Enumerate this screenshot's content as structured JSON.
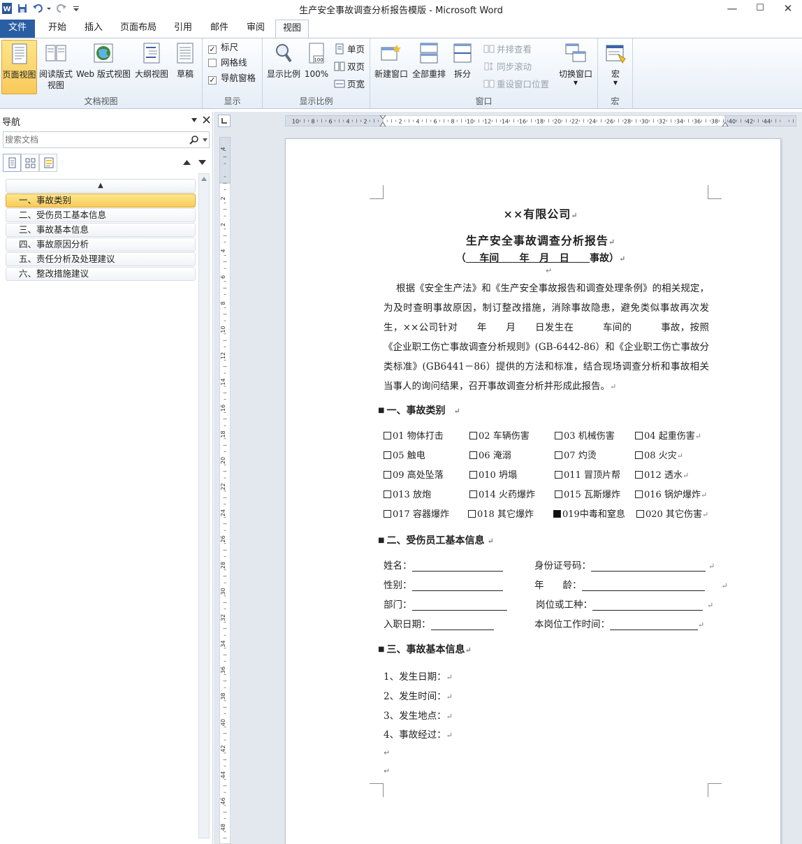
{
  "window": {
    "title": "生产安全事故调查分析报告模版 - Microsoft Word",
    "min": "—",
    "max": "☐",
    "close": "✕"
  },
  "tabs": [
    "文件",
    "开始",
    "插入",
    "页面布局",
    "引用",
    "邮件",
    "审阅",
    "视图"
  ],
  "ribbon": {
    "views": {
      "label": "文档视图",
      "print_layout": "页面视图",
      "reading_line1": "阅读版式",
      "reading_line2": "视图",
      "web": "Web 版式视图",
      "outline": "大纲视图",
      "draft": "草稿"
    },
    "show": {
      "label": "显示",
      "ruler": "标尺",
      "gridlines": "网格线",
      "nav_pane": "导航窗格"
    },
    "zoom": {
      "label": "显示比例",
      "zoom": "显示比例",
      "hundred": "100%",
      "one_page": "单页",
      "two_pages": "双页",
      "page_width": "页宽",
      "hundred_badge": "100"
    },
    "window": {
      "label": "窗口",
      "new_window": "新建窗口",
      "arrange_all": "全部重排",
      "split": "拆分",
      "side_by_side": "并排查看",
      "sync_scroll": "同步滚动",
      "reset_pos": "重设窗口位置",
      "switch": "切换窗口"
    },
    "macros": {
      "label": "宏",
      "macros": "宏"
    }
  },
  "nav": {
    "title": "导航",
    "search_placeholder": "搜索文档",
    "up": "▲",
    "items": [
      {
        "label": "一、事故类别",
        "selected": true
      },
      {
        "label": "二、受伤员工基本信息",
        "selected": false
      },
      {
        "label": "三、事故基本信息",
        "selected": false
      },
      {
        "label": "四、事故原因分析",
        "selected": false
      },
      {
        "label": "五、责任分析及处理建议",
        "selected": false
      },
      {
        "label": "六、整改措施建议",
        "selected": false
      }
    ]
  },
  "document": {
    "company": "××有限公司",
    "title": "生产安全事故调查分析报告",
    "subtitle": {
      "open": "（",
      "workshop": "    车间    ",
      "year": "  年 ",
      "month": "  月 ",
      "day": "  日      ",
      "close": "事故）"
    },
    "intro": "根据《安全生产法》和《生产安全事故报告和调查处理条例》的相关规定，为及时查明事故原因，制订整改措施，消除事故隐患，避免类似事故再次发生，××公司针对　　年　　月　　日发生在　　　车间的　　　事故，按照《企业职工伤亡事故调查分析规则》(GB-6442-86）和《企业职工伤亡事故分类标准》(GB6441－86）提供的方法和标准，结合现场调查分析和事故相关当事人的询问结果，召开事故调查分析并形成此报告。",
    "sections": {
      "s1": "一、事故类别",
      "s2": "二、受伤员工基本信息",
      "s3": "三、事故基本信息"
    },
    "categories": [
      [
        {
          "code": "01",
          "name": "物体打击",
          "checked": false
        },
        {
          "code": "02",
          "name": "车辆伤害",
          "checked": false
        },
        {
          "code": "03",
          "name": "机械伤害",
          "checked": false
        },
        {
          "code": "04",
          "name": "起重伤害",
          "checked": false
        }
      ],
      [
        {
          "code": "05",
          "name": "触电",
          "checked": false
        },
        {
          "code": "06",
          "name": "淹溺",
          "checked": false
        },
        {
          "code": "07",
          "name": "灼烫",
          "checked": false
        },
        {
          "code": "08",
          "name": "火灾",
          "checked": false
        }
      ],
      [
        {
          "code": "09",
          "name": "高处坠落",
          "checked": false
        },
        {
          "code": "010",
          "name": "坍塌",
          "checked": false
        },
        {
          "code": "011",
          "name": "冒顶片帮",
          "checked": false
        },
        {
          "code": "012",
          "name": "透水",
          "checked": false
        }
      ],
      [
        {
          "code": "013",
          "name": "放炮",
          "checked": false
        },
        {
          "code": "014",
          "name": "火药爆炸",
          "checked": false
        },
        {
          "code": "015",
          "name": "瓦斯爆炸",
          "checked": false
        },
        {
          "code": "016",
          "name": "锅炉爆炸",
          "checked": false
        }
      ],
      [
        {
          "code": "017",
          "name": "容器爆炸",
          "checked": false
        },
        {
          "code": "018",
          "name": "其它爆炸",
          "checked": false
        },
        {
          "code": "019",
          "name": "中毒和窒息",
          "checked": true
        },
        {
          "code": "020",
          "name": "其它伤害",
          "checked": false
        }
      ]
    ],
    "employee_form": {
      "name": "姓名：",
      "id_number": "身份证号码：",
      "gender": "性别：",
      "age": "年　　龄：",
      "dept": "部门：",
      "position": "岗位或工种：",
      "hire_date": "入职日期：",
      "tenure": "本岗位工作时间："
    },
    "basic_info": [
      "1、发生日期：",
      "2、发生时间：",
      "3、发生地点：",
      "4、事故经过："
    ],
    "para_mark": "↵"
  },
  "rulers": {
    "h_labels": [
      "10",
      "8",
      "6",
      "4",
      "2",
      "2",
      "4",
      "6",
      "8",
      "10",
      "12",
      "14",
      "16",
      "18",
      "20",
      "22",
      "24",
      "26",
      "28",
      "30",
      "32",
      "34",
      "36",
      "38",
      "40",
      "42",
      "44"
    ],
    "v_labels": [
      "4",
      "2",
      "2",
      "4",
      "6",
      "8",
      "10",
      "12",
      "14",
      "16",
      "18",
      "20",
      "22",
      "24",
      "26",
      "28",
      "30",
      "32",
      "34",
      "36",
      "38",
      "40",
      "42",
      "44",
      "46",
      "48"
    ]
  }
}
